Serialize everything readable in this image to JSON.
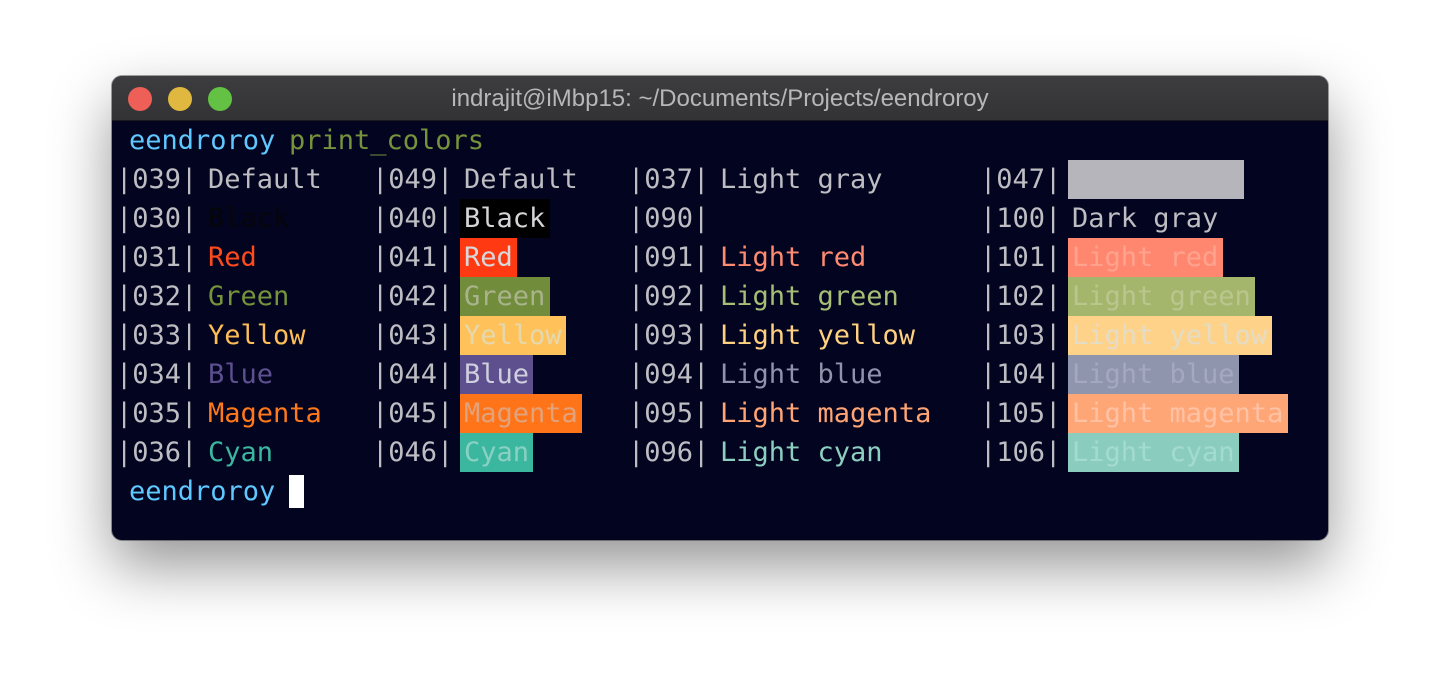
{
  "window": {
    "title": "indrajit@iMbp15: ~/Documents/Projects/eendroroy",
    "traffic_lights": {
      "close": "#ed5f57",
      "minimize": "#e0b83f",
      "maximize": "#63c244"
    }
  },
  "terminal": {
    "background": "#020420",
    "prompt": {
      "name": "eendroroy",
      "command": "print_colors"
    },
    "rows": [
      {
        "c1": {
          "code": "|039|",
          "label": "Default",
          "fg": "#bdbdc2"
        },
        "c2": {
          "code": "|049|",
          "label": "Default",
          "fg": "#bdbdc2"
        },
        "c3": {
          "code": "|037|",
          "label": "Light gray",
          "fg": "#bdbdc2"
        },
        "c4": {
          "code": "|047|",
          "label": "",
          "fg": "#b5b5bb",
          "bg": "#b5b5bb",
          "width": 176
        }
      },
      {
        "c1": {
          "code": "|030|",
          "label": "Black",
          "fg": "#05050b"
        },
        "c2": {
          "code": "|040|",
          "label": "Black",
          "fg": "#d5d5d8",
          "bg": "#000000"
        },
        "c3": {
          "code": "|090|",
          "label": "",
          "fg": "#020420"
        },
        "c4": {
          "code": "|100|",
          "label": "Dark gray",
          "fg": "#bdbdc2"
        }
      },
      {
        "c1": {
          "code": "|031|",
          "label": "Red",
          "fg": "#ff4a1c"
        },
        "c2": {
          "code": "|041|",
          "label": "Red",
          "fg": "#d8d8da",
          "bg": "#ff3a12"
        },
        "c3": {
          "code": "|091|",
          "label": "Light red",
          "fg": "#ff8a70"
        },
        "c4": {
          "code": "|101|",
          "label": "Light red",
          "fg": "#ffa28e",
          "bg": "#ff8770"
        }
      },
      {
        "c1": {
          "code": "|032|",
          "label": "Green",
          "fg": "#76923a"
        },
        "c2": {
          "code": "|042|",
          "label": "Green",
          "fg": "#a9b38c",
          "bg": "#718c3b"
        },
        "c3": {
          "code": "|092|",
          "label": "Light green",
          "fg": "#a8be74"
        },
        "c4": {
          "code": "|102|",
          "label": "Light green",
          "fg": "#b9c78f",
          "bg": "#a4b66b"
        }
      },
      {
        "c1": {
          "code": "|033|",
          "label": "Yellow",
          "fg": "#ffbe55"
        },
        "c2": {
          "code": "|043|",
          "label": "Yellow",
          "fg": "#e6d8ad",
          "bg": "#ffc15a"
        },
        "c3": {
          "code": "|093|",
          "label": "Light yellow",
          "fg": "#ffd080"
        },
        "c4": {
          "code": "|103|",
          "label": "Light yellow",
          "fg": "#e4dcc4",
          "bg": "#ffd289"
        }
      },
      {
        "c1": {
          "code": "|034|",
          "label": "Blue",
          "fg": "#5e4f8f"
        },
        "c2": {
          "code": "|044|",
          "label": "Blue",
          "fg": "#cfcfdf",
          "bg": "#5e4f8f"
        },
        "c3": {
          "code": "|094|",
          "label": "Light blue",
          "fg": "#9093ab"
        },
        "c4": {
          "code": "|104|",
          "label": "Light blue",
          "fg": "#a5a9bf",
          "bg": "#8f95ad"
        }
      },
      {
        "c1": {
          "code": "|035|",
          "label": "Magenta",
          "fg": "#ff781a"
        },
        "c2": {
          "code": "|045|",
          "label": "Magenta",
          "fg": "#e2a27c",
          "bg": "#ff7418"
        },
        "c3": {
          "code": "|095|",
          "label": "Light magenta",
          "fg": "#ffa472"
        },
        "c4": {
          "code": "|105|",
          "label": "Light magenta",
          "fg": "#ffc2a5",
          "bg": "#ffa677"
        }
      },
      {
        "c1": {
          "code": "|036|",
          "label": "Cyan",
          "fg": "#3bb7a0"
        },
        "c2": {
          "code": "|046|",
          "label": "Cyan",
          "fg": "#8ad0c3",
          "bg": "#3bb7a0"
        },
        "c3": {
          "code": "|096|",
          "label": "Light cyan",
          "fg": "#8ccfc0"
        },
        "c4": {
          "code": "|106|",
          "label": "Light cyan",
          "fg": "#a4dbd0",
          "bg": "#8acdbf"
        }
      }
    ],
    "end_prompt": {
      "name": "eendroroy"
    }
  }
}
